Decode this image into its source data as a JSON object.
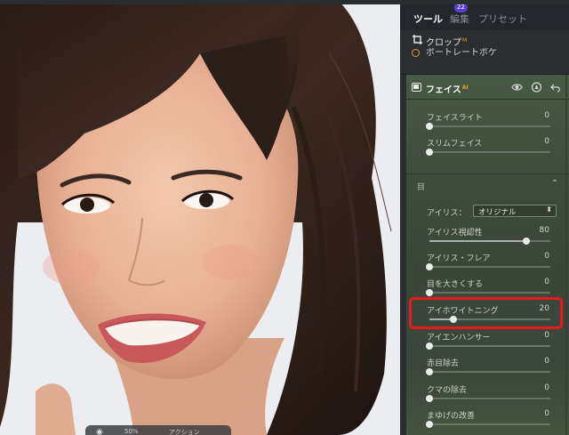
{
  "tabs": {
    "tools": "ツール",
    "edit": "編集",
    "edit_badge": "22",
    "presets": "プリセット"
  },
  "crop": {
    "label": "クロップ",
    "badge": "M"
  },
  "portrait": {
    "label": "ポートレートボケ"
  },
  "face": {
    "title": "フェイス",
    "badge": "AI",
    "header_icons": [
      "eye-icon",
      "pen-icon",
      "undo-icon"
    ],
    "sliders_top": [
      {
        "label": "フェイスライト",
        "value": "0",
        "fraction": 0.0
      },
      {
        "label": "スリムフェイス",
        "value": "0",
        "fraction": 0.0
      }
    ],
    "eyes_section": {
      "title": "目",
      "collapse_icon": "chevron-up-icon"
    },
    "iris": {
      "label": "アイリス：",
      "selected": "オリジナル",
      "arrow": "⌃⌄"
    },
    "sliders_eye": [
      {
        "label": "アイリス視認性",
        "value": "80",
        "fraction": 0.8
      },
      {
        "label": "アイリス・フレア",
        "value": "0",
        "fraction": 0.0
      },
      {
        "label": "目を大きくする",
        "value": "0",
        "fraction": 0.0
      },
      {
        "label": "アイホワイトニング",
        "value": "20",
        "fraction": 0.2
      },
      {
        "label": "アイエンハンサー",
        "value": "0",
        "fraction": 0.0
      },
      {
        "label": "赤目除去",
        "value": "0",
        "fraction": 0.0
      },
      {
        "label": "クマの除去",
        "value": "0",
        "fraction": 0.0
      },
      {
        "label": "まゆげの改善",
        "value": "0",
        "fraction": 0.0
      }
    ]
  },
  "bottom_toolbar": {
    "zoom": "50%",
    "action": "アクション"
  },
  "colors": {
    "accent": "#5b3fd4",
    "highlight": "#e8191d",
    "badge": "#f0a11a"
  }
}
